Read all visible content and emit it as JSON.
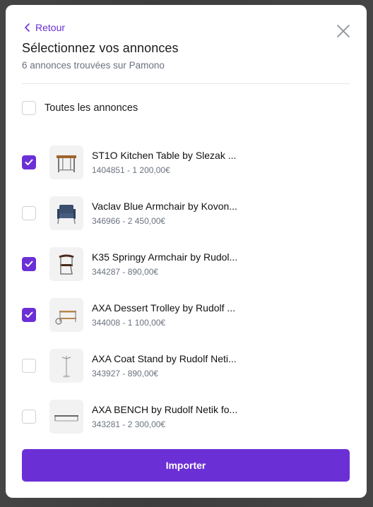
{
  "header": {
    "back_label": "Retour",
    "title": "Sélectionnez vos annonces",
    "subtitle": "6 annonces trouvées sur Pamono"
  },
  "select_all": {
    "label": "Toutes les annonces",
    "checked": false
  },
  "items": [
    {
      "title": "ST1O Kitchen Table by Slezak ...",
      "meta": "1404851 - 1 200,00€",
      "checked": true,
      "thumb": "table"
    },
    {
      "title": "Vaclav Blue Armchair by Kovon...",
      "meta": "346966 - 2 450,00€",
      "checked": false,
      "thumb": "armchair"
    },
    {
      "title": "K35 Springy Armchair by Rudol...",
      "meta": "344287 - 890,00€",
      "checked": true,
      "thumb": "springy-chair"
    },
    {
      "title": "AXA Dessert Trolley by Rudolf ...",
      "meta": "344008 - 1 100,00€",
      "checked": true,
      "thumb": "trolley"
    },
    {
      "title": "AXA Coat Stand by Rudolf Neti...",
      "meta": "343927 - 890,00€",
      "checked": false,
      "thumb": "coat-stand"
    },
    {
      "title": "AXA BENCH by Rudolf Netik fo...",
      "meta": "343281 - 2 300,00€",
      "checked": false,
      "thumb": "bench"
    }
  ],
  "import_button": {
    "label": "Importer"
  },
  "colors": {
    "accent": "#6b2fd6",
    "text": "#1b1b1f",
    "muted": "#6b7280"
  }
}
